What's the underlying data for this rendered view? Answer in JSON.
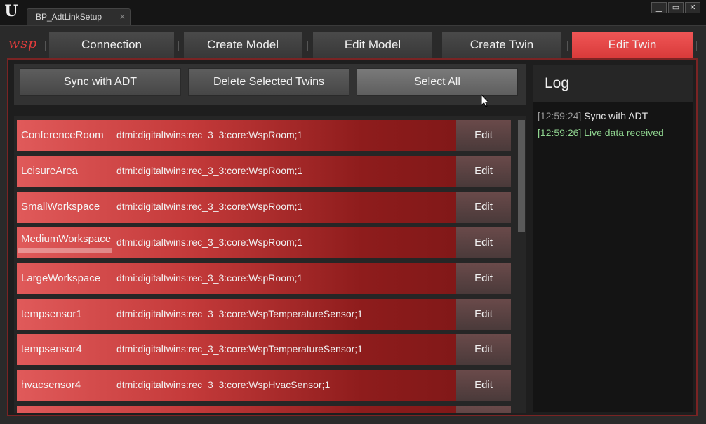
{
  "window": {
    "tab_title": "BP_AdtLinkSetup",
    "tab_close": "×",
    "controls": [
      "▁",
      "▭",
      "✕"
    ]
  },
  "brand": "wsp",
  "nav": {
    "tabs": [
      {
        "label": "Connection",
        "active": false
      },
      {
        "label": "Create Model",
        "active": false
      },
      {
        "label": "Edit Model",
        "active": false
      },
      {
        "label": "Create Twin",
        "active": false
      },
      {
        "label": "Edit Twin",
        "active": true
      }
    ]
  },
  "toolbar": {
    "sync_label": "Sync with ADT",
    "delete_label": "Delete Selected Twins",
    "select_all_label": "Select All"
  },
  "twins": [
    {
      "name": "ConferenceRoom",
      "model": "dtmi:digitaltwins:rec_3_3:core:WspRoom;1",
      "edit": "Edit"
    },
    {
      "name": "LeisureArea",
      "model": "dtmi:digitaltwins:rec_3_3:core:WspRoom;1",
      "edit": "Edit"
    },
    {
      "name": "SmallWorkspace",
      "model": "dtmi:digitaltwins:rec_3_3:core:WspRoom;1",
      "edit": "Edit"
    },
    {
      "name": "MediumWorkspace",
      "model": "dtmi:digitaltwins:rec_3_3:core:WspRoom;1",
      "edit": "Edit"
    },
    {
      "name": "LargeWorkspace",
      "model": "dtmi:digitaltwins:rec_3_3:core:WspRoom;1",
      "edit": "Edit"
    },
    {
      "name": "tempsensor1",
      "model": "dtmi:digitaltwins:rec_3_3:core:WspTemperatureSensor;1",
      "edit": "Edit"
    },
    {
      "name": "tempsensor4",
      "model": "dtmi:digitaltwins:rec_3_3:core:WspTemperatureSensor;1",
      "edit": "Edit"
    },
    {
      "name": "hvacsensor4",
      "model": "dtmi:digitaltwins:rec_3_3:core:WspHvacSensor;1",
      "edit": "Edit"
    }
  ],
  "log": {
    "title": "Log",
    "entries": [
      {
        "time": "[12:59:24]",
        "message": "Sync with ADT",
        "status": "info"
      },
      {
        "time": "[12:59:26]",
        "message": "Live data received",
        "status": "success"
      }
    ]
  },
  "colors": {
    "accent": "#e04545",
    "active_tab": "#f05656",
    "row_gradient_start": "#e05a5a",
    "row_gradient_end": "#7a1616",
    "log_success": "#8fd48f"
  }
}
